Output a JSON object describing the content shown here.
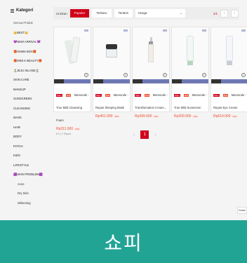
{
  "sidebar": {
    "title": "Kategori",
    "items": [
      {
        "label": "Semua Produk",
        "sub": false
      },
      {
        "label": "👑BEST👑",
        "sub": false
      },
      {
        "label": "💜NEW ARRIVAL💜",
        "sub": false
      },
      {
        "label": "🎁OHMS BOX🎁",
        "sub": false
      },
      {
        "label": "🎁MINI K BEAUTY🎁",
        "sub": false
      },
      {
        "label": "🏝️JEJU ISLAND🏝️",
        "sub": false
      },
      {
        "label": "SKIN CARE",
        "sub": false
      },
      {
        "label": "MAKEUP",
        "sub": false
      },
      {
        "label": "SUNSCREEN",
        "sub": false
      },
      {
        "label": "CLEANSING",
        "sub": false
      },
      {
        "label": "MASK",
        "sub": false
      },
      {
        "label": "HAIR",
        "sub": false
      },
      {
        "label": "BODY",
        "sub": false
      },
      {
        "label": "PATCH",
        "sub": false
      },
      {
        "label": "KIDS",
        "sub": false
      },
      {
        "label": "LIFESTYLE",
        "sub": false
      },
      {
        "label": "🟪SKIN PROBLEM🟪",
        "sub": false
      },
      {
        "label": "Acne",
        "sub": true
      },
      {
        "label": "Dry Skin",
        "sub": true
      },
      {
        "label": "Whitening",
        "sub": true
      }
    ]
  },
  "sort": {
    "label": "Urutkan",
    "buttons": [
      "Populer",
      "Terbaru",
      "Terlaris"
    ],
    "price_select": "Harga",
    "page_indicator": "1/1"
  },
  "products": [
    {
      "badges": [
        "Star+",
        "Mall"
      ],
      "name": "Mamonde - True Mild Cleansing Foam",
      "price": "Rp311.000",
      "discount": "30%",
      "meta": "5.0 | 1 Terjual"
    },
    {
      "badges": [
        "Star+",
        "Mall"
      ],
      "name": "Mamonde - Repair Sleeping Mask",
      "price": "Rp461.000",
      "discount": "30%",
      "meta": ""
    },
    {
      "badges": [
        "Star+",
        "Mall"
      ],
      "name": "Mamonde - Transformation Cream...",
      "price": "Rp399.000",
      "discount": "30%",
      "meta": ""
    },
    {
      "badges": [
        "Star+",
        "Mall"
      ],
      "name": "Mamonde - True Mild Sunscreen",
      "price": "Rp209.000",
      "discount": "30%",
      "meta": ""
    },
    {
      "badges": [
        "Star+",
        "Mall"
      ],
      "name": "Mamonde - Repair Eye Cream",
      "price": "Rp614.000",
      "discount": "30%",
      "meta": ""
    }
  ],
  "pagination": {
    "prev": "‹",
    "current": "1",
    "next": "›"
  },
  "footer_tab": "Dowlo",
  "banner": {
    "text": "쇼피",
    "color": "#22a495"
  },
  "colors": {
    "accent": "#d0011b",
    "price": "#ee4d2d"
  }
}
